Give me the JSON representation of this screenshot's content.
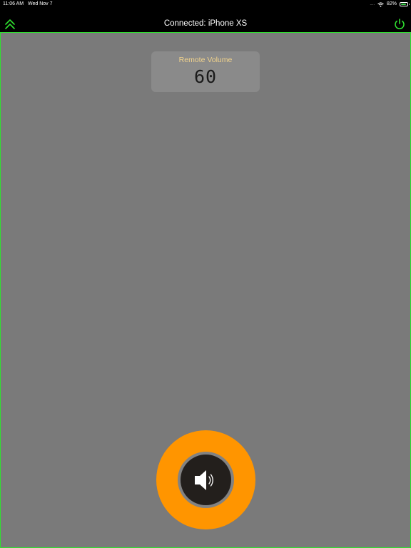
{
  "status_bar": {
    "time": "11:06 AM",
    "date": "Wed Nov 7",
    "signal": "....",
    "battery_percent": "82%",
    "battery_level": 0.82
  },
  "nav": {
    "title": "Connected: iPhone XS",
    "left_icon": "double-chevron-up-icon",
    "right_icon": "power-icon"
  },
  "volume": {
    "label": "Remote Volume",
    "value": "60"
  },
  "speaker_button": {
    "icon": "speaker-icon"
  },
  "colors": {
    "accent_green": "#2fe02f",
    "button_orange": "#ff9500",
    "label_yellow": "#f0d28c",
    "background_gray": "#7a7a7a"
  }
}
